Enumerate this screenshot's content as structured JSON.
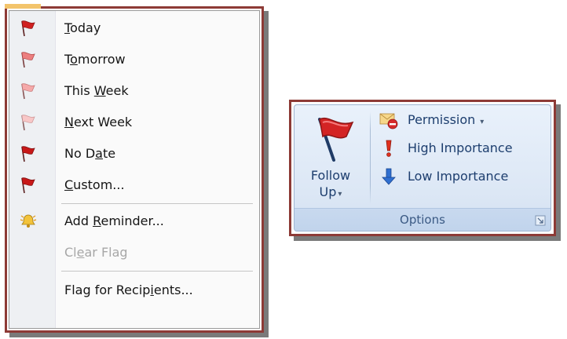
{
  "flag_menu": {
    "items": [
      {
        "pre": "",
        "key": "T",
        "post": "oday",
        "icon": "flag-red-icon",
        "enabled": true
      },
      {
        "pre": "T",
        "key": "o",
        "post": "morrow",
        "icon": "flag-rose-icon",
        "enabled": true
      },
      {
        "pre": "This ",
        "key": "W",
        "post": "eek",
        "icon": "flag-light-pink-icon",
        "enabled": true
      },
      {
        "pre": "",
        "key": "N",
        "post": "ext Week",
        "icon": "flag-pale-pink-icon",
        "enabled": true
      },
      {
        "pre": "No D",
        "key": "a",
        "post": "te",
        "icon": "flag-red-icon",
        "enabled": true
      },
      {
        "pre": "",
        "key": "C",
        "post": "ustom...",
        "icon": "flag-red-icon",
        "enabled": true
      },
      {
        "pre": "Add ",
        "key": "R",
        "post": "eminder...",
        "icon": "bell-icon",
        "enabled": true
      },
      {
        "pre": "Cl",
        "key": "e",
        "post": "ar Flag",
        "icon": "",
        "enabled": false
      },
      {
        "pre": "Flag for Recip",
        "key": "i",
        "post": "ents...",
        "icon": "",
        "enabled": true
      }
    ]
  },
  "options_group": {
    "follow_up": {
      "line1": "Follow",
      "line2": "Up",
      "icon": "follow-up-flag-icon"
    },
    "buttons": [
      {
        "label": "Permission",
        "icon": "envelope-permission-icon",
        "has_dropdown": true
      },
      {
        "label": "High Importance",
        "icon": "exclamation-icon",
        "has_dropdown": false
      },
      {
        "label": "Low Importance",
        "icon": "down-arrow-icon",
        "has_dropdown": false
      }
    ],
    "group_label": "Options"
  },
  "colors": {
    "frame": "#8d3a36",
    "flag_red": "#d02020",
    "flag_rose": "#ec7f7f",
    "flag_light": "#f5a9a9",
    "flag_pale": "#f8c7c7",
    "ribbon_text": "#1d3e6e"
  }
}
